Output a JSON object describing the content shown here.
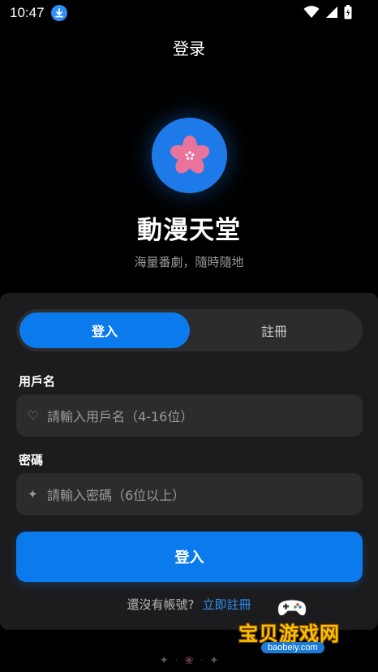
{
  "status_bar": {
    "time": "10:47"
  },
  "header": {
    "title": "登录"
  },
  "brand": {
    "app_name": "動漫天堂",
    "tagline": "海量番劇，隨時隨地"
  },
  "auth_tabs": {
    "login_label": "登入",
    "register_label": "註冊"
  },
  "form": {
    "username_label": "用戶名",
    "username_placeholder": "請輸入用戶名（4-16位）",
    "username_icon": "♡",
    "password_label": "密碼",
    "password_placeholder": "請輸入密碼（6位以上）",
    "password_icon": "✦",
    "submit_label": "登入"
  },
  "register_prompt": {
    "question": "還沒有帳號?",
    "link": "立即註冊"
  },
  "footer_deco": {
    "left": "✦",
    "middle": "❀",
    "right": "✦",
    "dot": "·"
  },
  "watermark": {
    "name": "宝贝游戏网",
    "url": "baobeiy.com"
  },
  "colors": {
    "background": "#000000",
    "card": "#1c1c1e",
    "accent": "#0a7aec",
    "link": "#2f8ff5",
    "field": "#2c2c2e",
    "flower": "#e8739b"
  }
}
